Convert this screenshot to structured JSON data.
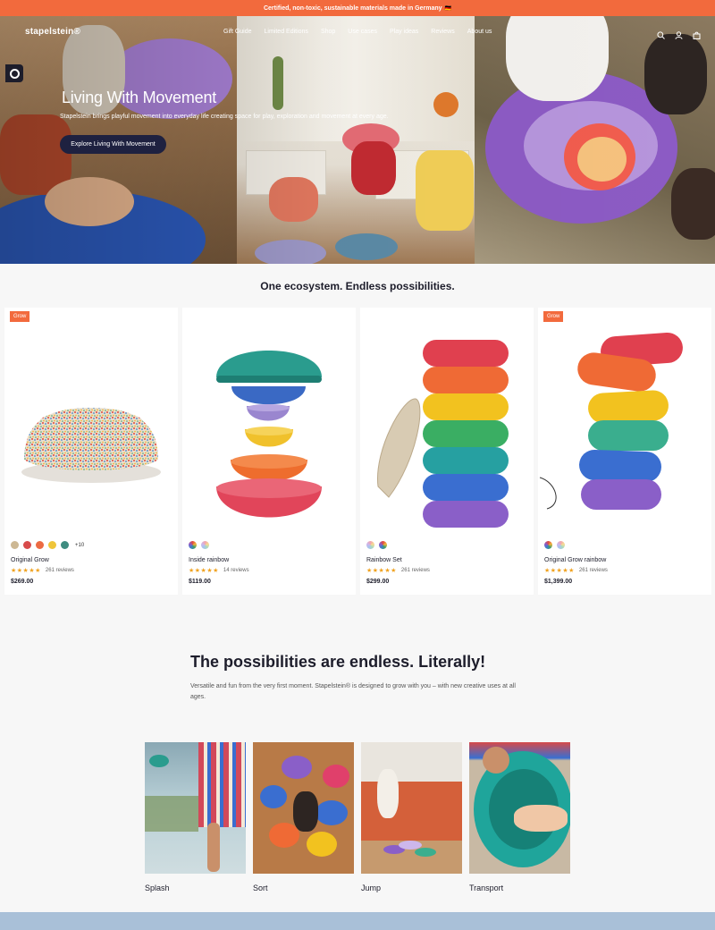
{
  "announcement": {
    "text": "Certified, non-toxic, sustainable materials made in Germany",
    "flag": "🇩🇪"
  },
  "header": {
    "logo": "stapelstein®",
    "menu": [
      "Gift Guide",
      "Limited Editions",
      "Shop",
      "Use cases",
      "Play ideas",
      "Reviews",
      "About us"
    ],
    "icons": [
      "search-icon",
      "account-icon",
      "cart-icon"
    ]
  },
  "hero": {
    "title": "Living With Movement",
    "subtitle": "Stapelstein brings playful movement into everyday life creating space for play, exploration and movement at every age.",
    "cta": "Explore Living With Movement"
  },
  "ecosystem": {
    "title": "One ecosystem. Endless possibilities.",
    "products": [
      {
        "badge": "Grow",
        "name": "Original Grow",
        "reviews": "261 reviews",
        "price": "$269.00",
        "more": "+10",
        "rating": 4.5,
        "swatches": [
          "#cdb894",
          "#d84b4b",
          "#ec6b43",
          "#efc53a",
          "#3f8c80"
        ]
      },
      {
        "badge": "",
        "name": "Inside rainbow",
        "reviews": "14 reviews",
        "price": "$119.00",
        "more": "",
        "rating": 4.5,
        "swatches": [
          "rainbow",
          "pastel"
        ]
      },
      {
        "badge": "",
        "name": "Rainbow Set",
        "reviews": "261 reviews",
        "price": "$299.00",
        "more": "",
        "rating": 4.5,
        "swatches": [
          "pastel",
          "rainbow"
        ]
      },
      {
        "badge": "Grow",
        "name": "Original Grow rainbow",
        "reviews": "261 reviews",
        "price": "$1,399.00",
        "more": "",
        "rating": 4.5,
        "swatches": [
          "rainbow",
          "pastel"
        ]
      }
    ]
  },
  "possibilities": {
    "title": "The possibilities are endless. Literally!",
    "text": "Versatile and fun from the very first moment. Stapelstein® is designed to grow with you – with new creative uses at all ages.",
    "uses": [
      "Splash",
      "Sort",
      "Jump",
      "Transport"
    ]
  },
  "colors": {
    "accent": "#f26a3d",
    "dark": "#1e2140",
    "star": "#f0a21f",
    "footer": "#a9c0d8"
  }
}
